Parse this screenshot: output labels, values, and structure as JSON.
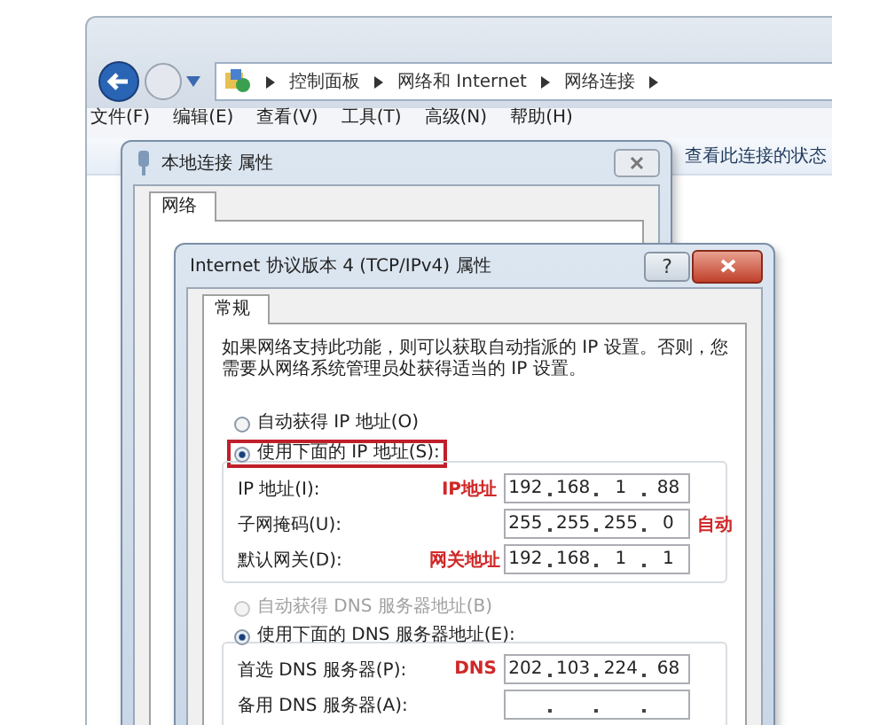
{
  "explorer": {
    "breadcrumb": [
      "控制面板",
      "网络和 Internet",
      "网络连接"
    ],
    "menu": [
      "文件(F)",
      "编辑(E)",
      "查看(V)",
      "工具(T)",
      "高级(N)",
      "帮助(H)"
    ],
    "toolbar_text": "查看此连接的状态"
  },
  "properties_dialog": {
    "title": "本地连接 属性",
    "tabs": [
      {
        "label": "网络",
        "selected": true
      }
    ]
  },
  "ipv4_dialog": {
    "title": "Internet 协议版本 4 (TCP/IPv4) 属性",
    "help_button": "?",
    "tabs": [
      {
        "label": "常规",
        "selected": true
      }
    ],
    "description": "如果网络支持此功能，则可以获取自动指派的 IP 设置。否则，您需要从网络系统管理员处获得适当的 IP 设置。",
    "ip_options": [
      {
        "label": "自动获得 IP 地址(O)",
        "selected": false,
        "disabled": false,
        "highlighted": false
      },
      {
        "label": "使用下面的 IP 地址(S):",
        "selected": true,
        "disabled": false,
        "highlighted": true
      }
    ],
    "ip_fields": [
      {
        "label": "IP 地址(I):",
        "note_before": "IP地址",
        "octets": [
          "192",
          "168",
          "1",
          "88"
        ]
      },
      {
        "label": "子网掩码(U):",
        "note_after": "自动",
        "octets": [
          "255",
          "255",
          "255",
          "0"
        ]
      },
      {
        "label": "默认网关(D):",
        "note_before": "网关地址",
        "octets": [
          "192",
          "168",
          "1",
          "1"
        ]
      }
    ],
    "dns_options": [
      {
        "label": "自动获得 DNS 服务器地址(B)",
        "selected": false,
        "disabled": true,
        "highlighted": false
      },
      {
        "label": "使用下面的 DNS 服务器地址(E):",
        "selected": true,
        "disabled": false,
        "highlighted": false
      }
    ],
    "dns_fields": [
      {
        "label": "首选 DNS 服务器(P):",
        "note_before": "DNS",
        "octets": [
          "202",
          "103",
          "224",
          "68"
        ]
      },
      {
        "label": "备用 DNS 服务器(A):"
      }
    ]
  }
}
